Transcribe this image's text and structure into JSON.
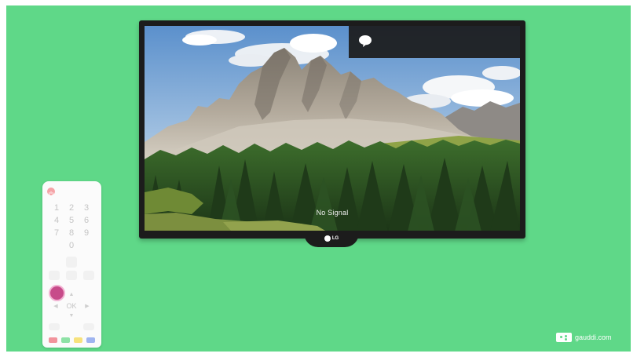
{
  "tv": {
    "status": "No Signal",
    "brand": "LG",
    "notification_icon": "chat-bubble-icon"
  },
  "remote": {
    "power_icon": "power-icon",
    "number_rows": [
      [
        "1",
        "2",
        "3"
      ],
      [
        "4",
        "5",
        "6"
      ],
      [
        "7",
        "8",
        "9"
      ],
      [
        "0"
      ]
    ],
    "ok_label": "OK",
    "color_buttons": [
      "#f2939c",
      "#8ee2a6",
      "#f7e27c",
      "#9fb4f0"
    ],
    "press_indicator_color": "#c74b8a"
  },
  "watermark": {
    "text": "gauddi.com"
  },
  "colors": {
    "background": "#5fd888",
    "tv_frame": "#1c1c1c"
  }
}
